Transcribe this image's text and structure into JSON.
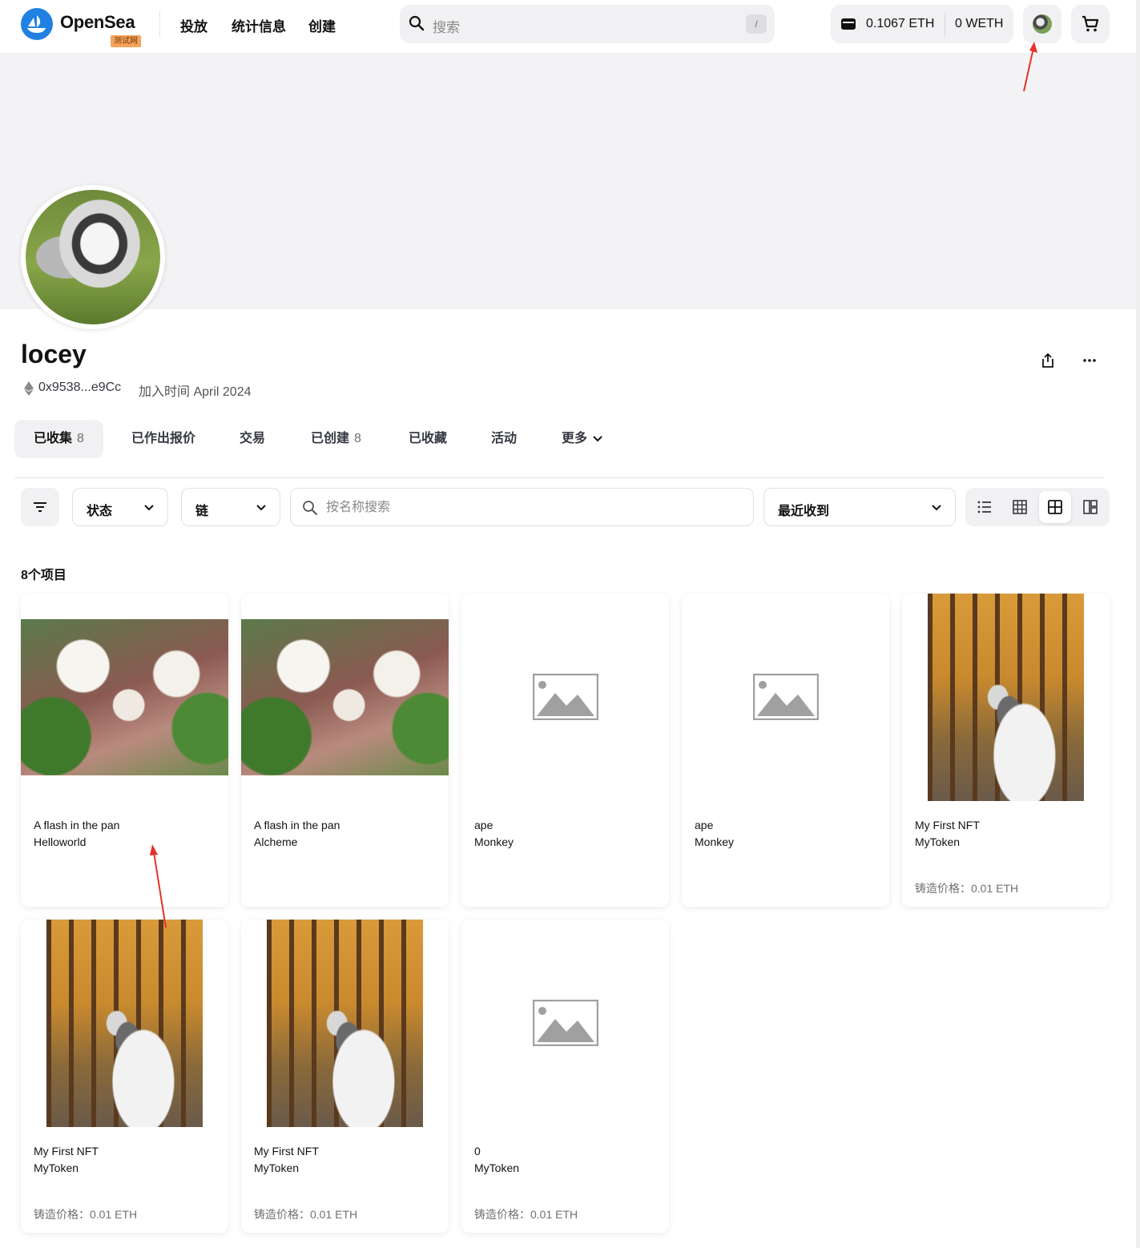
{
  "nav": {
    "brand": "OpenSea",
    "testnet_badge": "测试网",
    "links": [
      "投放",
      "统计信息",
      "创建"
    ],
    "search_placeholder": "搜索",
    "search_shortcut": "/",
    "wallet_eth": "0.1067 ETH",
    "wallet_weth": "0 WETH"
  },
  "profile": {
    "username": "locey",
    "address": "0x9538...e9Cc",
    "joined": "加入时间 April 2024"
  },
  "tabs": [
    {
      "label": "已收集",
      "count": "8"
    },
    {
      "label": "已作出报价",
      "count": ""
    },
    {
      "label": "交易",
      "count": ""
    },
    {
      "label": "已创建",
      "count": "8"
    },
    {
      "label": "已收藏",
      "count": ""
    },
    {
      "label": "活动",
      "count": ""
    },
    {
      "label": "更多",
      "count": ""
    }
  ],
  "filters": {
    "status": "状态",
    "chain": "链",
    "name_search_placeholder": "按名称搜索",
    "sort": "最近收到"
  },
  "items_count": "8个项目",
  "items": [
    {
      "title": "A flash in the pan",
      "collection": "Helloworld",
      "price": "",
      "image": "flower"
    },
    {
      "title": "A flash in the pan",
      "collection": "Alcheme",
      "price": "",
      "image": "flower"
    },
    {
      "title": "ape",
      "collection": "Monkey",
      "price": "",
      "image": "placeholder"
    },
    {
      "title": "ape",
      "collection": "Monkey",
      "price": "",
      "image": "placeholder"
    },
    {
      "title": "My First NFT",
      "collection": "MyToken",
      "price": "铸造价格：0.01 ETH",
      "image": "dog"
    },
    {
      "title": "My First NFT",
      "collection": "MyToken",
      "price": "铸造价格：0.01 ETH",
      "image": "dog"
    },
    {
      "title": "My First NFT",
      "collection": "MyToken",
      "price": "铸造价格：0.01 ETH",
      "image": "dog"
    },
    {
      "title": "0",
      "collection": "MyToken",
      "price": "铸造价格：0.01 ETH",
      "image": "placeholder"
    }
  ],
  "colors": {
    "brand_blue": "#2081e2",
    "annotation_red": "#e8302a",
    "testnet_badge": "#f8a25b"
  }
}
